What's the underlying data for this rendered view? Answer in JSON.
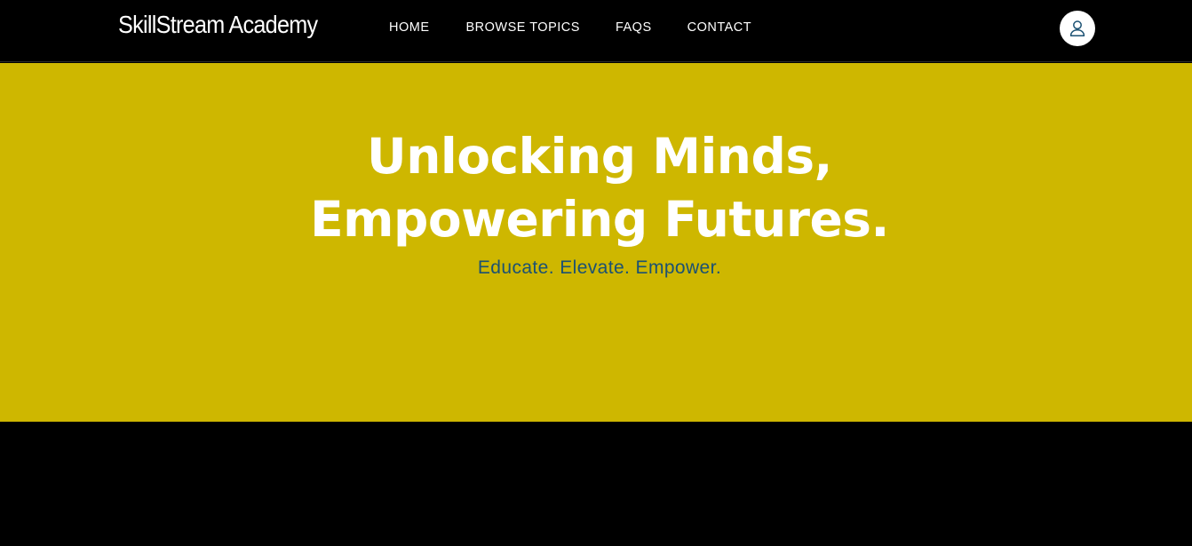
{
  "header": {
    "brand": "SkillStream Academy",
    "nav": [
      {
        "label": "HOME"
      },
      {
        "label": "BROWSE TOPICS"
      },
      {
        "label": "FAQS"
      },
      {
        "label": "CONTACT"
      }
    ],
    "account_icon": "user-icon"
  },
  "hero": {
    "title_line1": "Unlocking Minds,",
    "title_line2": "Empowering Futures.",
    "subtitle": "Educate. Elevate. Empower."
  },
  "colors": {
    "header_bg": "#000000",
    "hero_bg": "#ceb700",
    "hero_title": "#ffffff",
    "hero_subtitle": "#1b5173",
    "icon": "#1b5173"
  }
}
